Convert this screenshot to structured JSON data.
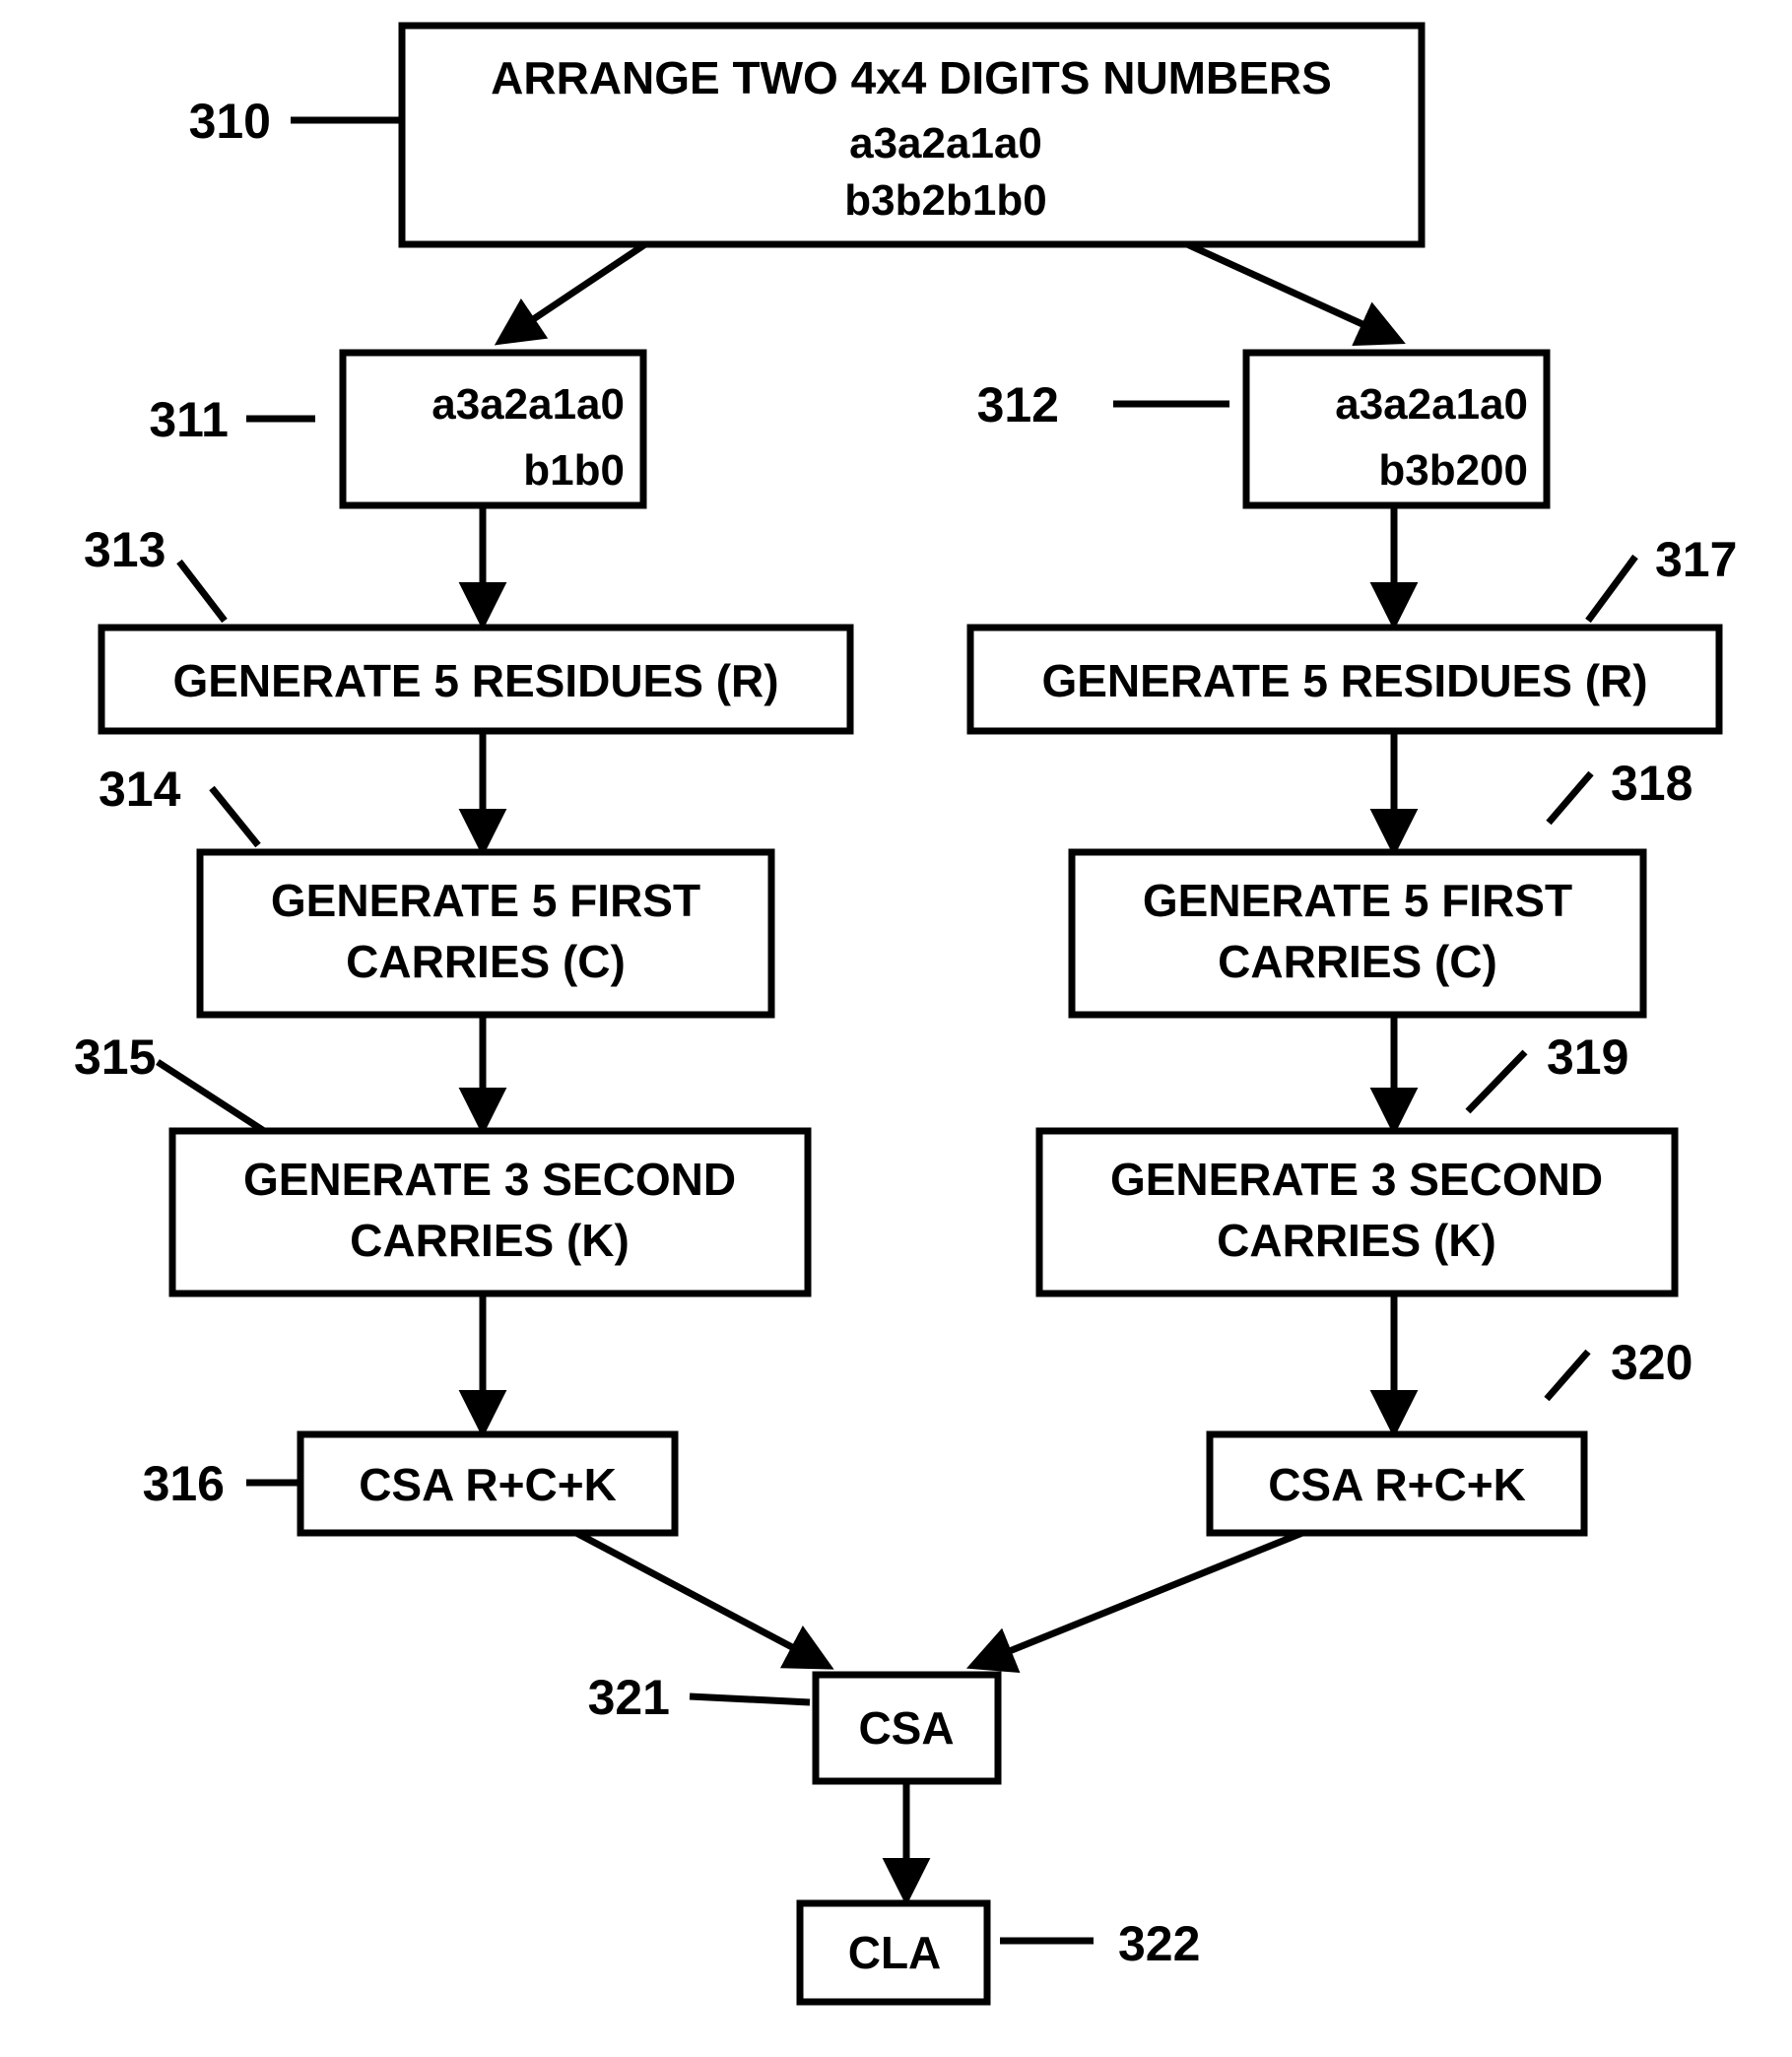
{
  "figure": {
    "type": "patent-flowchart",
    "background_color": "#ffffff",
    "line_color": "#000000"
  },
  "boxes": {
    "arrange": {
      "ref": "310",
      "line1": "ARRANGE TWO 4x4 DIGITS NUMBERS",
      "line2": "a3a2a1a0",
      "line3": "b3b2b1b0"
    },
    "left_operand": {
      "ref": "311",
      "line1": "a3a2a1a0",
      "line2": "b1b0"
    },
    "right_operand": {
      "ref": "312",
      "line1": "a3a2a1a0",
      "line2": "b3b200"
    },
    "left_residues": {
      "ref": "313",
      "line1": "GENERATE 5 RESIDUES (R)"
    },
    "left_first_carries": {
      "ref": "314",
      "line1": "GENERATE 5 FIRST",
      "line2": "CARRIES (C)"
    },
    "left_second_carries": {
      "ref": "315",
      "line1": "GENERATE 3 SECOND",
      "line2": "CARRIES (K)"
    },
    "left_csa": {
      "ref": "316",
      "line1": "CSA R+C+K"
    },
    "right_residues": {
      "ref": "317",
      "line1": "GENERATE 5 RESIDUES (R)"
    },
    "right_first_carries": {
      "ref": "318",
      "line1": "GENERATE 5 FIRST",
      "line2": "CARRIES (C)"
    },
    "right_second_carries": {
      "ref": "319",
      "line1": "GENERATE 3 SECOND",
      "line2": "CARRIES (K)"
    },
    "right_csa": {
      "ref": "320",
      "line1": "CSA R+C+K"
    },
    "merge_csa": {
      "ref": "321",
      "line1": "CSA"
    },
    "cla": {
      "ref": "322",
      "line1": "CLA"
    }
  }
}
